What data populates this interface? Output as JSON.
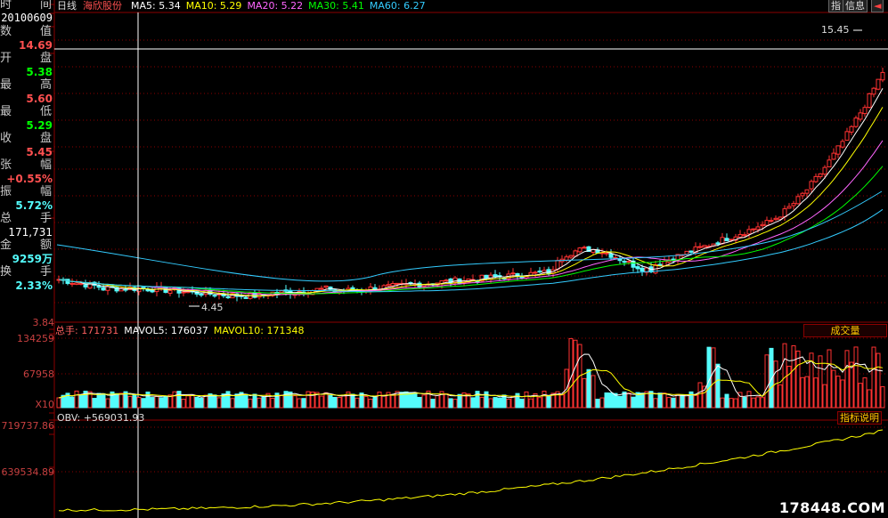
{
  "window": {
    "title": "日线",
    "stock": "海欣股份"
  },
  "ma_legend": [
    {
      "label": "MA5: 5.34",
      "color": "#ffffff"
    },
    {
      "label": "MA10: 5.29",
      "color": "#ffff00"
    },
    {
      "label": "MA20: 5.22",
      "color": "#ff66ff"
    },
    {
      "label": "MA30: 5.41",
      "color": "#00ff00"
    },
    {
      "label": "MA60: 6.27",
      "color": "#33ccff"
    }
  ],
  "buttons": {
    "info1": "指",
    "info2": "信息",
    "arrow": "◄"
  },
  "info_panel": {
    "time_label": [
      "时",
      "间"
    ],
    "time_value": "20100609",
    "value_label": [
      "数",
      "值"
    ],
    "value_value": "14.69",
    "open_label": [
      "开",
      "盘"
    ],
    "open_value": "5.38",
    "high_label": [
      "最",
      "高"
    ],
    "high_value": "5.60",
    "low_label": [
      "最",
      "低"
    ],
    "low_value": "5.29",
    "close_label": [
      "收",
      "盘"
    ],
    "close_value": "5.45",
    "change_label": [
      "张",
      "幅"
    ],
    "change_value": "+0.55%",
    "amplitude_label": [
      "振",
      "幅"
    ],
    "amplitude_value": "5.72%",
    "vol_label": [
      "总",
      "手"
    ],
    "vol_value": "171,731",
    "amount_label": [
      "金",
      "额"
    ],
    "amount_value": "9259万",
    "turnover_label": [
      "换",
      "手"
    ],
    "turnover_value": "2.33%"
  },
  "price_axis": {
    "bottom": "3.84"
  },
  "price_annotations": {
    "high": "15.45",
    "low": "4.45"
  },
  "volume_panel": {
    "header": [
      {
        "label": "总手: 171731",
        "color": "#ff6060"
      },
      {
        "label": "MAVOL5: 176037",
        "color": "#ffffff"
      },
      {
        "label": "MAVOL10: 171348",
        "color": "#ffff00"
      }
    ],
    "button": "成交量",
    "axis": [
      "134259",
      "67958",
      "X10"
    ]
  },
  "obv_panel": {
    "header": "OBV: +569031.93",
    "button": "指标说明",
    "axis": [
      "719737.86",
      "639534.89"
    ]
  },
  "watermark": "178448.COM",
  "colors": {
    "up": "#ff3232",
    "down": "#54fcfc",
    "grid": "#8b0000",
    "ma5": "#ffffff",
    "ma10": "#ffff00",
    "ma20": "#ff66ff",
    "ma30": "#00ff00",
    "ma60": "#33ccff",
    "obv": "#ffff00"
  }
}
